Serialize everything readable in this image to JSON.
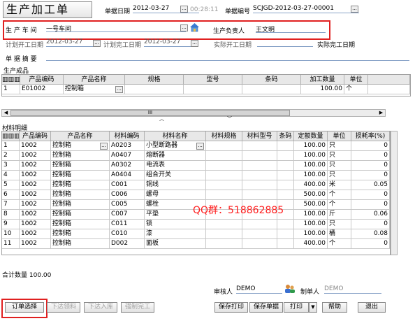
{
  "form": {
    "title": "生产加工单",
    "doc_date_label": "单据日期",
    "doc_date": "2012-03-27",
    "doc_time": "00:28:11",
    "doc_no_label": "单据编号",
    "doc_no": "SCJGD-2012-03-27-00001",
    "workshop_label": "生 产  车 间",
    "workshop": "一号车间",
    "manager_label": "生产负责人",
    "manager": "王文明",
    "plan_start_label": "计划开工日期",
    "plan_start": "2012-03-27",
    "plan_end_label": "计划完工日期",
    "plan_end": "2012-03-27",
    "actual_start_label": "实际开工日期",
    "actual_end_label": "实际完工日期",
    "summary_label": "单 据  摘 要",
    "product_section": "生产成品"
  },
  "products": {
    "headers": [
      "产品编码",
      "产品名称",
      "规格",
      "型号",
      "条码",
      "加工数量",
      "单位"
    ],
    "rows": [
      {
        "idx": "1",
        "code": "E01002",
        "name": "控制箱",
        "spec": "",
        "model": "",
        "barcode": "",
        "qty": "100.00",
        "unit": "个"
      }
    ]
  },
  "scroll_glyph": "III",
  "materials": {
    "section": "材料明细",
    "headers": [
      "产品编码",
      "产品名称",
      "材料编码",
      "材料名称",
      "材料规格",
      "材料型号",
      "条码",
      "定额数量",
      "单位",
      "损耗率(%)"
    ],
    "rows": [
      {
        "idx": "1",
        "pcode": "1002",
        "pname": "控制箱",
        "mcode": "A0203",
        "mname": "小型断路器",
        "qty": "100.00",
        "unit": "只",
        "loss": "0"
      },
      {
        "idx": "2",
        "pcode": "1002",
        "pname": "控制箱",
        "mcode": "A0407",
        "mname": "熔断器",
        "qty": "100.00",
        "unit": "只",
        "loss": "0"
      },
      {
        "idx": "3",
        "pcode": "1002",
        "pname": "控制箱",
        "mcode": "A0302",
        "mname": "电流表",
        "qty": "100.00",
        "unit": "只",
        "loss": "0"
      },
      {
        "idx": "4",
        "pcode": "1002",
        "pname": "控制箱",
        "mcode": "A0404",
        "mname": "组合开关",
        "qty": "100.00",
        "unit": "只",
        "loss": "0"
      },
      {
        "idx": "5",
        "pcode": "1002",
        "pname": "控制箱",
        "mcode": "C001",
        "mname": "铜线",
        "qty": "400.00",
        "unit": "米",
        "loss": "0.05"
      },
      {
        "idx": "6",
        "pcode": "1002",
        "pname": "控制箱",
        "mcode": "C006",
        "mname": "螺母",
        "qty": "500.00",
        "unit": "个",
        "loss": "0"
      },
      {
        "idx": "7",
        "pcode": "1002",
        "pname": "控制箱",
        "mcode": "C005",
        "mname": "螺栓",
        "qty": "500.00",
        "unit": "个",
        "loss": "0"
      },
      {
        "idx": "8",
        "pcode": "1002",
        "pname": "控制箱",
        "mcode": "C007",
        "mname": "平垫",
        "qty": "100.00",
        "unit": "斤",
        "loss": "0.06"
      },
      {
        "idx": "9",
        "pcode": "1002",
        "pname": "控制箱",
        "mcode": "C011",
        "mname": "锁",
        "qty": "100.00",
        "unit": "只",
        "loss": "0"
      },
      {
        "idx": "10",
        "pcode": "1002",
        "pname": "控制箱",
        "mcode": "C010",
        "mname": "漆",
        "qty": "100.00",
        "unit": "桶",
        "loss": "0.08"
      },
      {
        "idx": "11",
        "pcode": "1002",
        "pname": "控制箱",
        "mcode": "D002",
        "mname": "面板",
        "qty": "400.00",
        "unit": "个",
        "loss": "0"
      }
    ]
  },
  "watermark": "QQ群：518862885",
  "total": "合计数量 100.00",
  "reviewer_label": "审核人",
  "reviewer": "DEMO",
  "creator_label": "制单人",
  "creator": "DEMO",
  "buttons": {
    "select_order": "订单选择",
    "issue_material": "下达领料",
    "issue_stock_in": "下达入库",
    "force_complete": "强制完工",
    "save_print": "保存打印",
    "save_doc": "保存单据",
    "print": "打印",
    "help": "帮助",
    "exit": "退出"
  },
  "colors": {
    "highlight": "#e02020",
    "watermark": "#ff2020"
  }
}
